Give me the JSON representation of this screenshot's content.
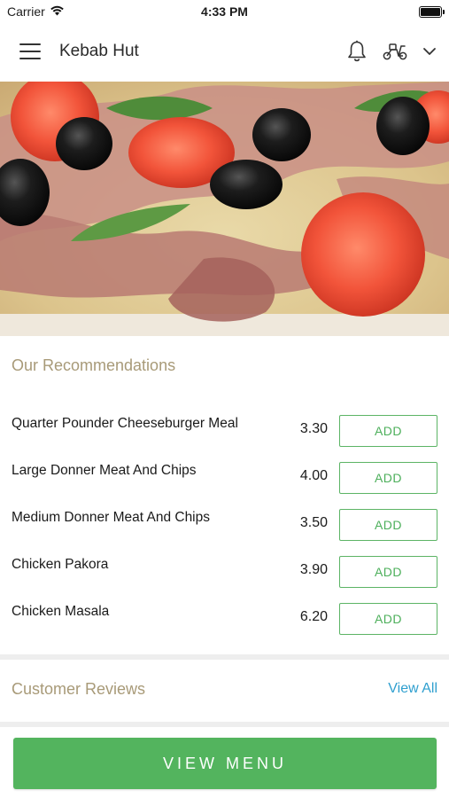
{
  "status_bar": {
    "carrier": "Carrier",
    "time": "4:33 PM"
  },
  "header": {
    "title": "Kebab Hut",
    "icons": [
      "menu-icon",
      "bell-icon",
      "scooter-icon",
      "chevron-down-icon"
    ]
  },
  "hero": {
    "image": "pizza-photo"
  },
  "recommendations": {
    "title": "Our Recommendations",
    "add_label": "ADD",
    "items": [
      {
        "name": "Quarter Pounder Cheeseburger Meal",
        "price": "3.30"
      },
      {
        "name": "Large Donner Meat And Chips",
        "price": "4.00"
      },
      {
        "name": "Medium Donner Meat And Chips",
        "price": "3.50"
      },
      {
        "name": "Chicken Pakora",
        "price": "3.90"
      },
      {
        "name": "Chicken Masala",
        "price": "6.20"
      }
    ]
  },
  "reviews": {
    "title": "Customer Reviews",
    "view_all": "View All"
  },
  "footer": {
    "view_menu": "VIEW MENU"
  },
  "colors": {
    "accent_green": "#53b45e",
    "section_title": "#a89a78",
    "link_blue": "#2f9fcf"
  }
}
